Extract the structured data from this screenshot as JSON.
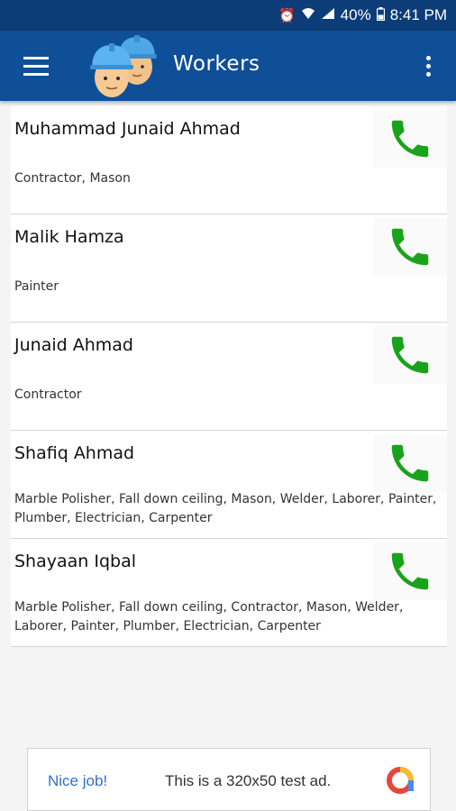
{
  "status_bar": {
    "battery": "40%",
    "time": "8:41 PM"
  },
  "app_bar": {
    "title": "Workers"
  },
  "workers": [
    {
      "name": "Muhammad Junaid Ahmad",
      "skills": "Contractor, Mason"
    },
    {
      "name": "Malik Hamza",
      "skills": "Painter"
    },
    {
      "name": "Junaid Ahmad",
      "skills": "Contractor"
    },
    {
      "name": "Shafiq Ahmad",
      "skills": "Marble Polisher,  Fall down ceiling, Mason, Welder, Laborer, Painter, Plumber, Electrician, Carpenter"
    },
    {
      "name": "Shayaan Iqbal",
      "skills": "Marble Polisher, Fall down ceiling, Contractor, Mason, Welder, Laborer, Painter, Plumber, Electrician, Carpenter"
    }
  ],
  "ad": {
    "label": "Nice job!",
    "text": "This is a 320x50 test ad."
  },
  "colors": {
    "app_bar": "#0e4f98",
    "status_bar": "#0d3d78",
    "call_icon": "#1aa31a",
    "ad_link": "#2f6fd0"
  }
}
